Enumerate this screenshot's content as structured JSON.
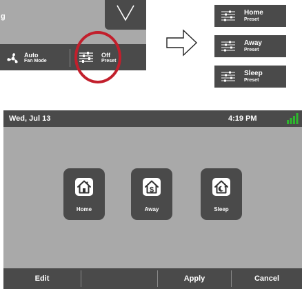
{
  "crop": {
    "title_fragment": "g",
    "fan": {
      "value": "Auto",
      "label": "Fan Mode"
    },
    "preset": {
      "value": "Off",
      "label": "Preset"
    }
  },
  "preset_options": [
    {
      "value": "Home",
      "label": "Preset"
    },
    {
      "value": "Away",
      "label": "Preset"
    },
    {
      "value": "Sleep",
      "label": "Preset"
    }
  ],
  "screen": {
    "status_bar": {
      "date": "Wed, Jul 13",
      "time": "4:19 PM",
      "signal_icon": "signal-bars-icon",
      "signal_color": "#2db82d"
    },
    "presets": [
      {
        "label": "Home",
        "icon": "house-icon"
      },
      {
        "label": "Away",
        "icon": "house-dollar-icon"
      },
      {
        "label": "Sleep",
        "icon": "house-moon-icon"
      }
    ],
    "bottom_bar": {
      "edit": "Edit",
      "apply": "Apply",
      "cancel": "Cancel"
    }
  },
  "colors": {
    "panel_dark": "#4a4a4a",
    "panel_light": "#a9a9a9",
    "highlight": "#c21f2c"
  }
}
